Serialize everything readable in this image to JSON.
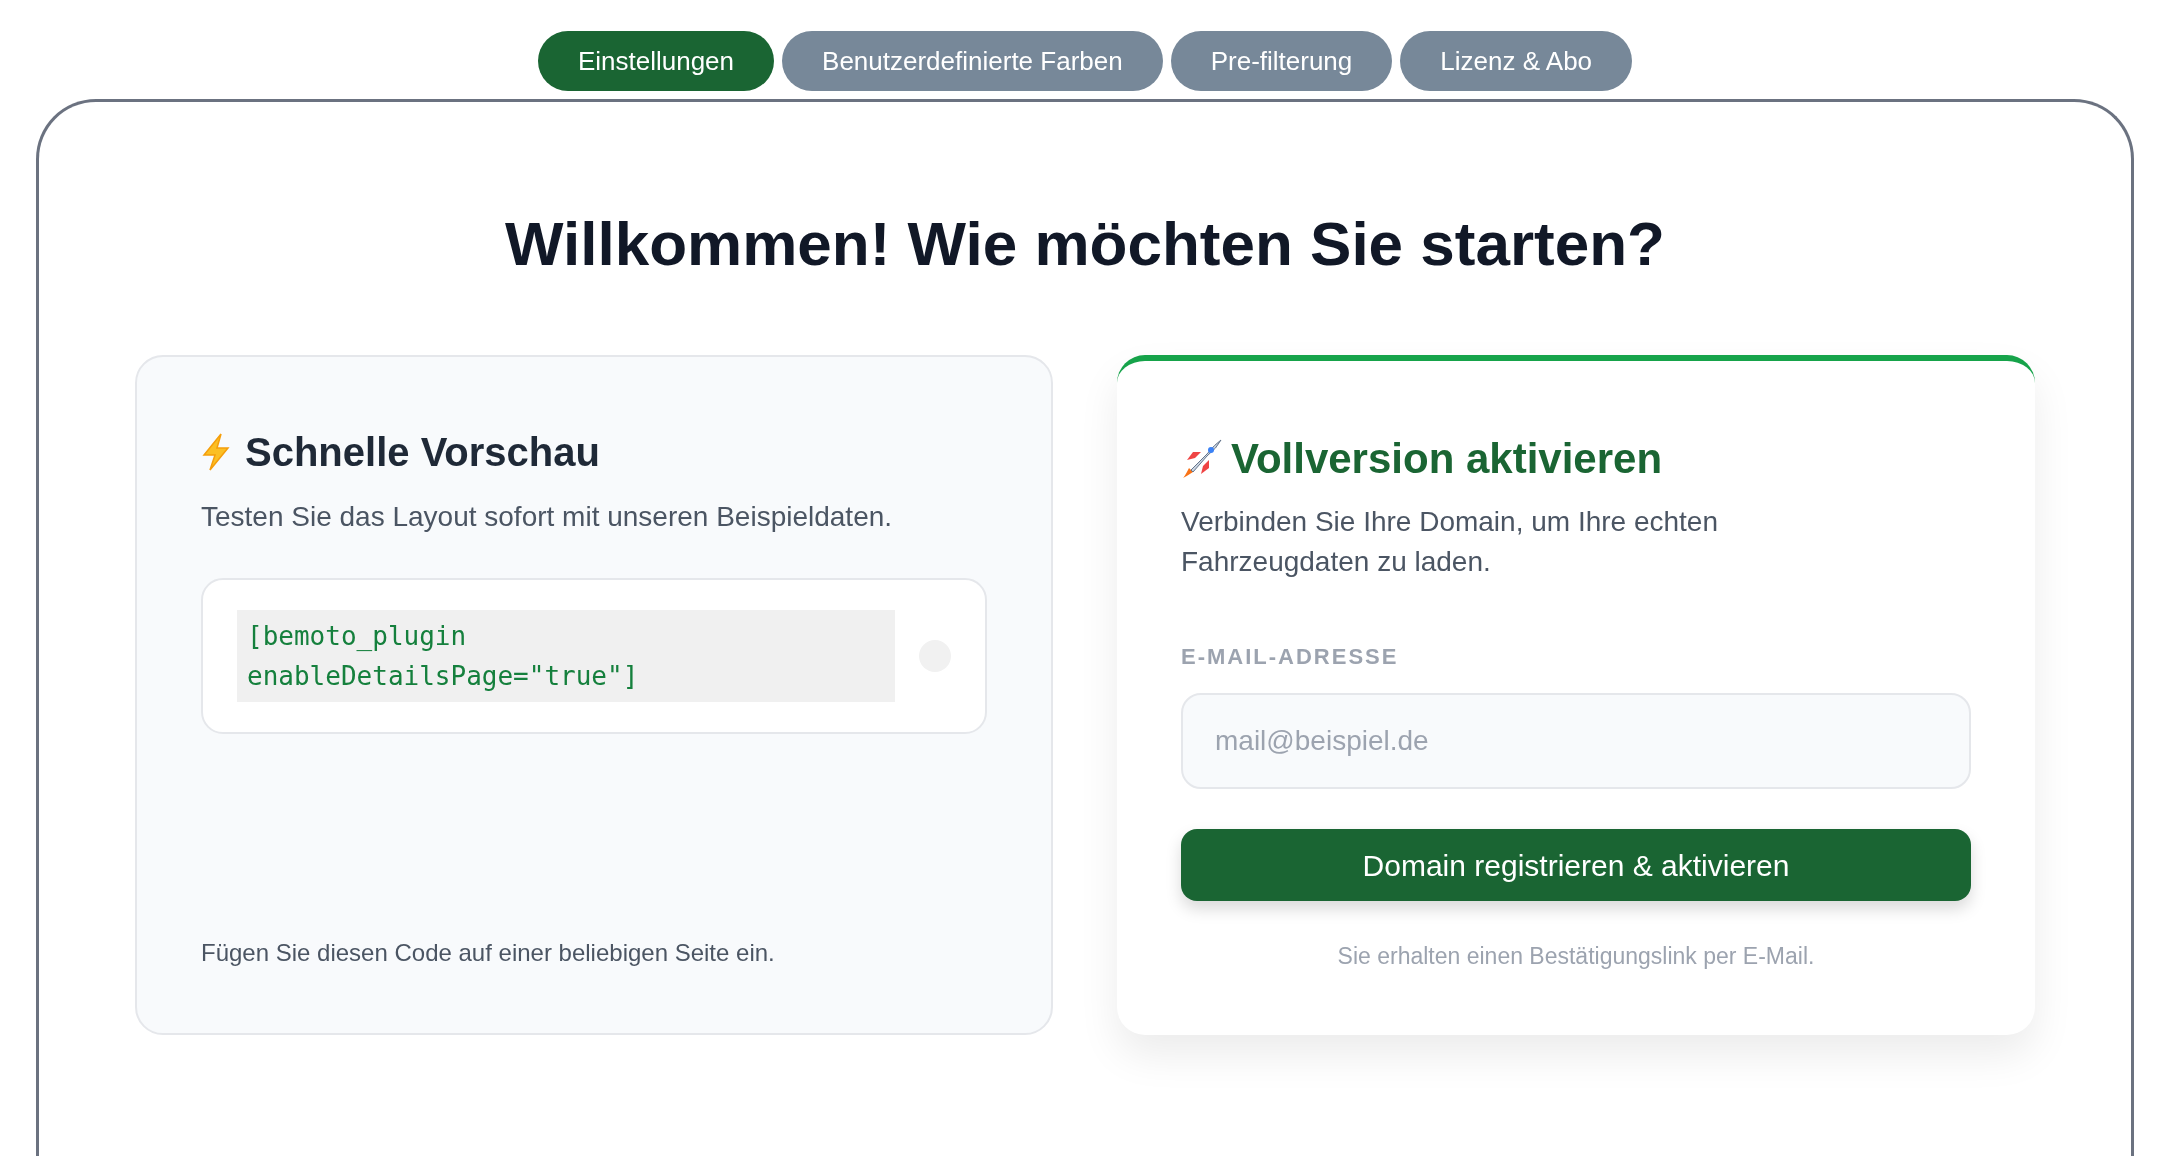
{
  "tabs": [
    {
      "label": "Einstellungen",
      "selected": true
    },
    {
      "label": "Benutzerdefinierte Farben",
      "selected": false
    },
    {
      "label": "Pre-filterung",
      "selected": false
    },
    {
      "label": "Lizenz & Abo",
      "selected": false
    }
  ],
  "heading": "Willkommen! Wie möchten Sie starten?",
  "preview_card": {
    "title": "Schnelle Vorschau",
    "description": "Testen Sie das Layout sofort mit unseren Beispieldaten.",
    "code": [
      "[bemoto_plugin",
      "enableDetailsPage=\"true\"]"
    ],
    "hint": "Fügen Sie diesen Code auf einer beliebigen Seite ein."
  },
  "activate_card": {
    "title": "Vollversion aktivieren",
    "description": "Verbinden Sie Ihre Domain, um Ihre echten Fahrzeugdaten zu laden.",
    "email_label": "E-MAIL-ADRESSE",
    "email": {
      "placeholder": "mail@beispiel.de"
    },
    "button": "Domain registrieren & aktivieren",
    "note": "Sie erhalten einen Bestätigungslink per E-Mail."
  }
}
